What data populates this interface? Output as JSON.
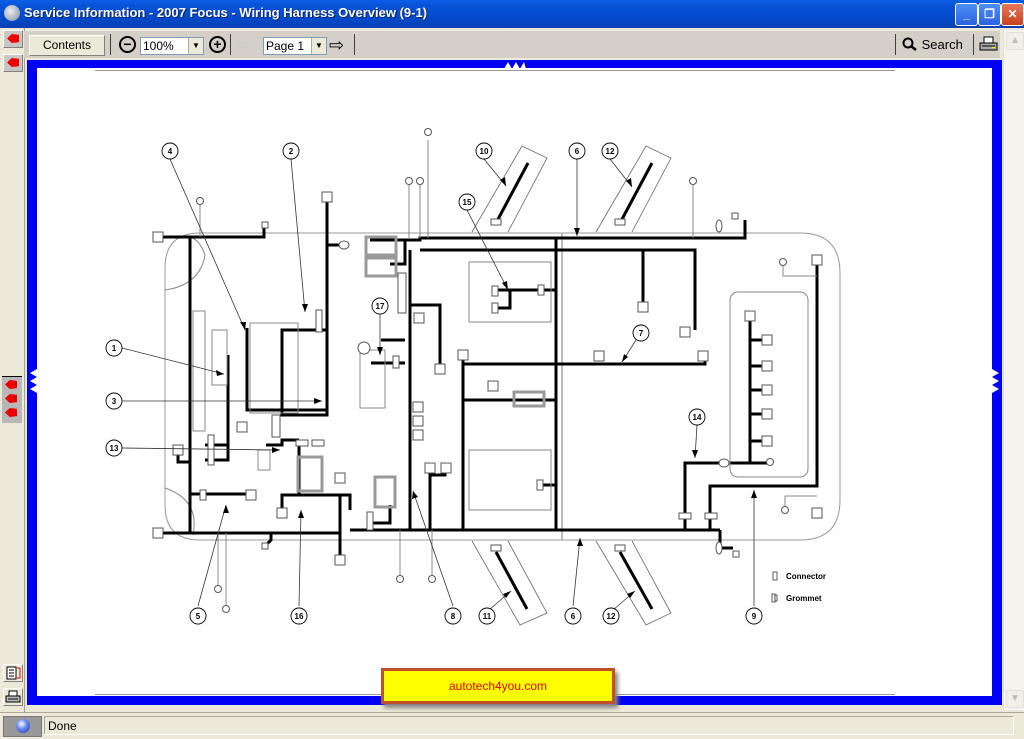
{
  "window": {
    "title": "Service Information - 2007 Focus - Wiring Harness Overview (9-1)",
    "controls": [
      "minimize",
      "restore",
      "close"
    ]
  },
  "toolbar": {
    "contents_label": "Contents",
    "zoom_out_icon": "zoom-out-icon",
    "zoom_value": "100%",
    "zoom_in_icon": "zoom-in-icon",
    "prev_icon": "back-arrow-icon",
    "page_value": "Page 1",
    "next_icon": "forward-arrow-icon",
    "search_label": "Search",
    "print_icon": "printer-icon"
  },
  "left_toolbar": {
    "buttons": [
      "red-arrow-icon",
      "red-arrow-icon",
      "red-arrow-icon",
      "red-arrow-icon",
      "red-arrow-icon",
      "document-icon",
      "printer-icon"
    ]
  },
  "diagram": {
    "callouts": [
      "1",
      "2",
      "3",
      "4",
      "5",
      "6",
      "7",
      "8",
      "9",
      "10",
      "11",
      "12",
      "13",
      "14",
      "15",
      "16",
      "17"
    ],
    "legend": {
      "connector": "Connector",
      "grommet": "Grommet"
    }
  },
  "watermark": "autotech4you.com",
  "status": {
    "text": "Done"
  }
}
